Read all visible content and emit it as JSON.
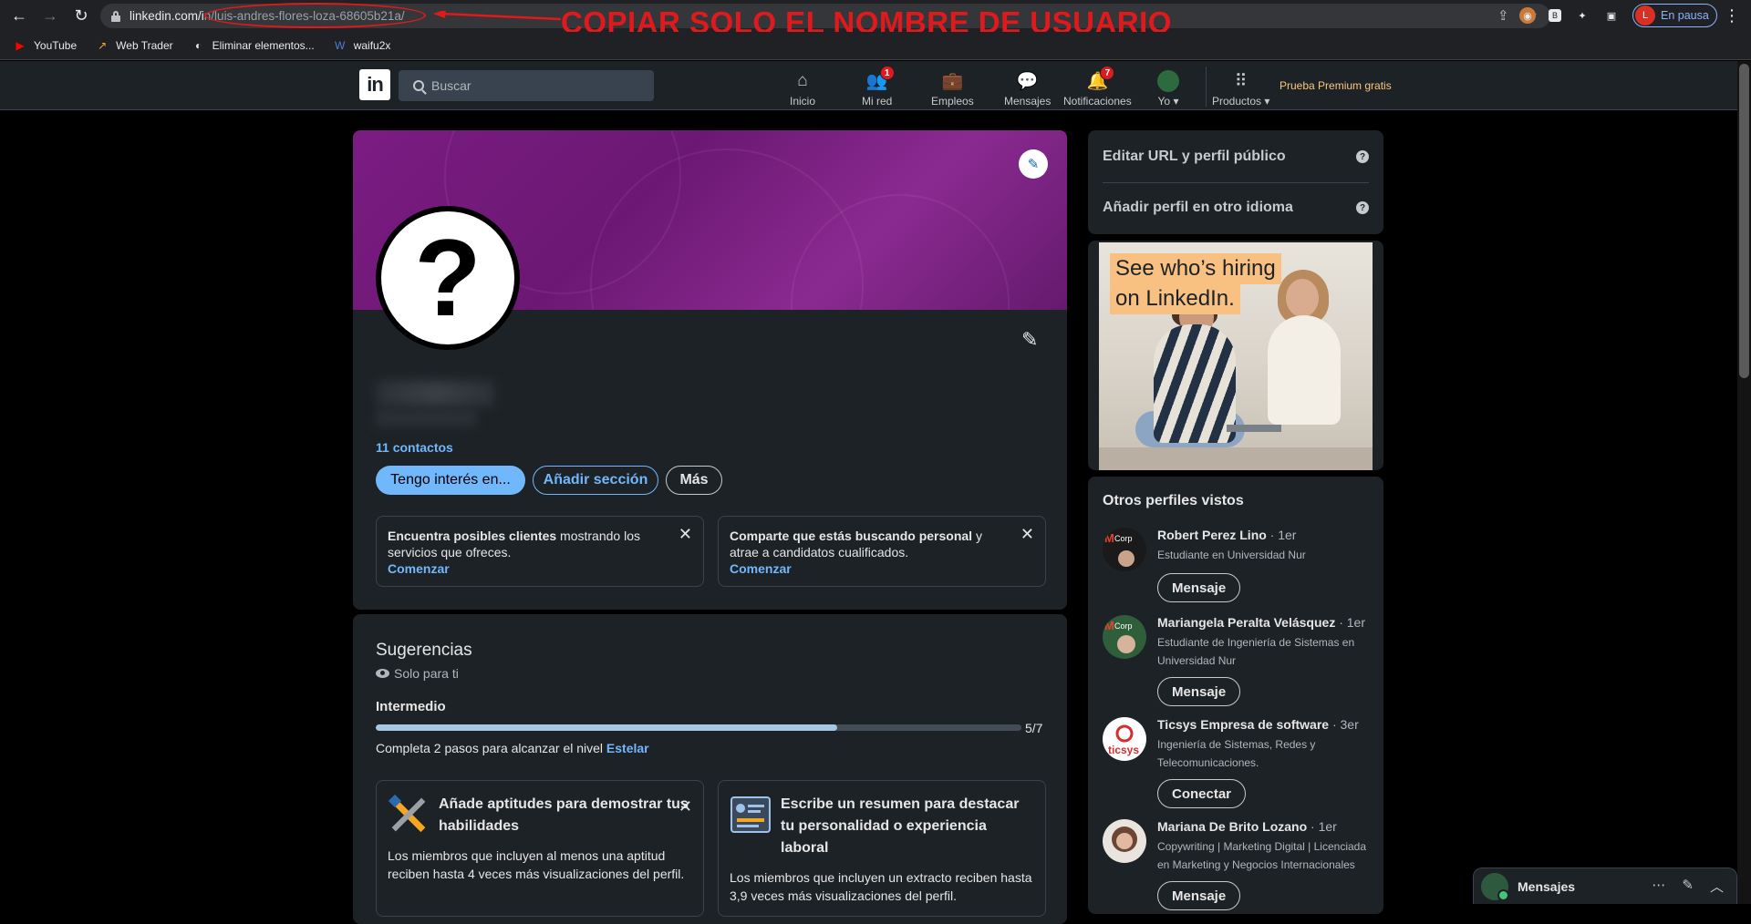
{
  "browser": {
    "url_domain": "linkedin.com/i",
    "url_path": "n/luis-andres-flores-loza-68605b21a/",
    "profile_status": "En pausa",
    "profile_initial": "L",
    "bookmarks": [
      {
        "label": "YouTube",
        "icon": "youtube-icon"
      },
      {
        "label": "Web Trader",
        "icon": "web-trader-icon"
      },
      {
        "label": "Eliminar elementos...",
        "icon": "eliminar-icon"
      },
      {
        "label": "waifu2x",
        "icon": "waifu2x-icon"
      }
    ]
  },
  "annotation": {
    "text": "COPIAR SOLO EL NOMBRE DE USUARIO",
    "color": "#e0191c"
  },
  "linkedin_nav": {
    "logo": "in",
    "search_placeholder": "Buscar",
    "items": [
      {
        "label": "Inicio",
        "icon": "home-icon",
        "badge": ""
      },
      {
        "label": "Mi red",
        "icon": "network-icon",
        "badge": "1"
      },
      {
        "label": "Empleos",
        "icon": "briefcase-icon",
        "badge": ""
      },
      {
        "label": "Mensajes",
        "icon": "chat-icon",
        "badge": ""
      },
      {
        "label": "Notificaciones",
        "icon": "bell-icon",
        "badge": "7"
      },
      {
        "label": "Yo",
        "icon": "avatar-icon",
        "badge": ""
      },
      {
        "label": "Productos",
        "icon": "grid-icon",
        "badge": ""
      }
    ],
    "premium": "Prueba Premium gratis"
  },
  "profile": {
    "contacts": "11 contactos",
    "btn_interest": "Tengo interés en...",
    "btn_add_section": "Añadir sección",
    "btn_more": "Más",
    "tips": [
      {
        "bold": "Encuentra posibles clientes",
        "rest": " mostrando los servicios que ofreces.",
        "link": "Comenzar"
      },
      {
        "bold": "Comparte que estás buscando personal",
        "rest": " y atrae a candidatos cualificados.",
        "link": "Comenzar"
      }
    ]
  },
  "suggestions": {
    "title": "Sugerencias",
    "subtitle": "Solo para ti",
    "level": "Intermedio",
    "progress_label": "5/7",
    "progress": 0.7143,
    "desc_text": "Completa 2 pasos para alcanzar el nivel ",
    "desc_link": "Estelar",
    "cards": [
      {
        "title": "Añade aptitudes para demostrar tus habilidades",
        "body": "Los miembros que incluyen al menos una aptitud reciben hasta 4 veces más visualizaciones del perfil.",
        "icon": "tools-icon"
      },
      {
        "title": "Escribe un resumen para destacar tu personalidad o experiencia laboral",
        "body": "Los miembros que incluyen un extracto reciben hasta 3,9 veces más visualizaciones del perfil.",
        "icon": "summary-icon"
      }
    ]
  },
  "sidebar": {
    "edit_url": "Editar URL y perfil público",
    "add_language": "Añadir perfil en otro idioma",
    "ad_line1": "See who’s hiring",
    "ad_line2": "on LinkedIn.",
    "others_title": "Otros perfiles vistos",
    "people": [
      {
        "name": "Robert Perez Lino",
        "degree": " · 1er",
        "headline": "Estudiante en Universidad Nur",
        "button": "Mensaje"
      },
      {
        "name": "Mariangela Peralta Velásquez",
        "degree": " · 1er",
        "headline": "Estudiante de Ingeniería de Sistemas en Universidad Nur",
        "button": "Mensaje"
      },
      {
        "name": "Ticsys Empresa de software",
        "degree": " · 3er",
        "headline": "Ingeniería de Sistemas, Redes y Telecomunicaciones.",
        "button": "Conectar"
      },
      {
        "name": "Mariana De Brito Lozano",
        "degree": " · 1er",
        "headline": "Copywriting | Marketing Digital | Licenciada en Marketing y Negocios Internacionales",
        "button": "Mensaje"
      }
    ]
  },
  "messaging": {
    "title": "Mensajes"
  }
}
